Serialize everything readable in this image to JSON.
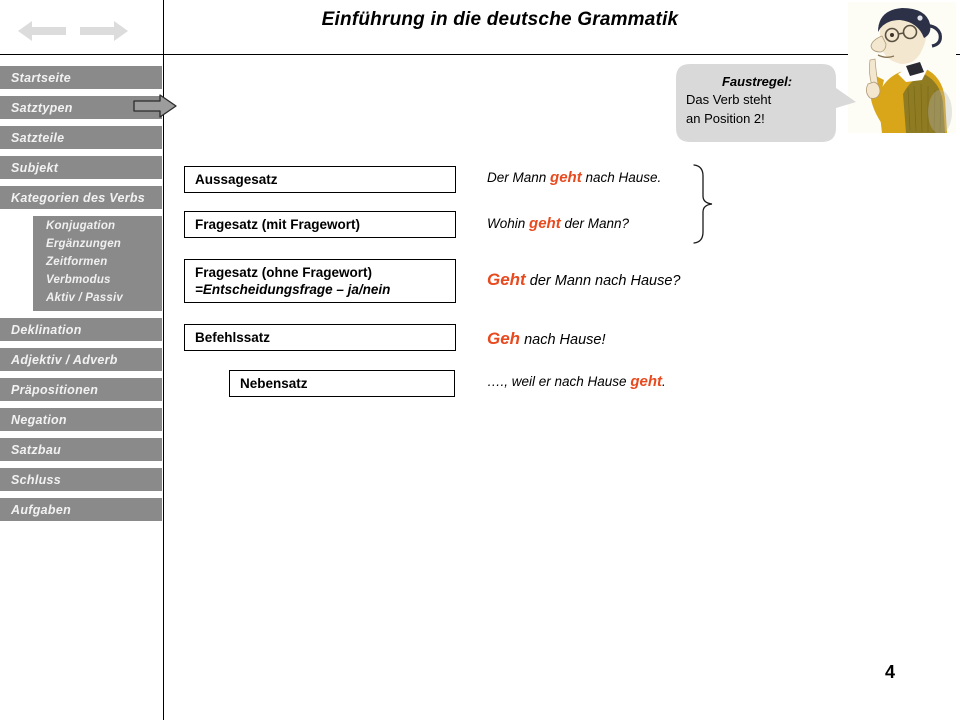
{
  "header": {
    "title": "Einführung in die deutsche Grammatik",
    "nav_back_icon": "arrow-left-icon",
    "nav_forward_icon": "arrow-right-icon"
  },
  "sidebar": {
    "items": [
      {
        "label": "Startseite"
      },
      {
        "label": "Satztypen",
        "active": true
      },
      {
        "label": "Satzteile"
      },
      {
        "label": "Subjekt"
      },
      {
        "label": "Kategorien des Verbs"
      }
    ],
    "subitems": [
      {
        "label": "Konjugation"
      },
      {
        "label": "Ergänzungen"
      },
      {
        "label": "Zeitformen"
      },
      {
        "label": "Verbmodus"
      },
      {
        "label": "Aktiv / Passiv"
      }
    ],
    "items_lower": [
      {
        "label": "Deklination"
      },
      {
        "label": "Adjektiv / Adverb"
      },
      {
        "label": "Präpositionen"
      },
      {
        "label": "Negation"
      },
      {
        "label": "Satzbau"
      },
      {
        "label": "Schluss"
      },
      {
        "label": "Aufgaben"
      }
    ],
    "pointer_icon": "arrow-right-pointer-icon",
    "background_color": "#8a8a8a",
    "text_color": "#f2f2f2"
  },
  "callout": {
    "title": "Faustregel:",
    "line1": "Das Verb steht",
    "line2": "an Position 2!",
    "background_color": "#d9d9d9"
  },
  "illustration": {
    "name": "professor-caricature-image"
  },
  "main": {
    "boxes": [
      {
        "line1": "Aussagesatz",
        "line2": ""
      },
      {
        "line1": "Fragesatz (mit Fragewort)",
        "line2": ""
      },
      {
        "line1": "Fragesatz (ohne Fragewort)",
        "line2": "=Entscheidungsfrage – ja/nein"
      },
      {
        "line1": "Befehlssatz",
        "line2": ""
      },
      {
        "line1": "Nebensatz",
        "line2": ""
      }
    ],
    "examples": [
      {
        "pre": "Der Mann ",
        "hl": "geht",
        "post": " nach Hause."
      },
      {
        "pre": "Wohin ",
        "hl": "geht",
        "post": " der Mann?"
      },
      {
        "pre": "",
        "hl": "Geht",
        "post": " der Mann nach Hause?"
      },
      {
        "pre": "",
        "hl": "Geh",
        "post": " nach Hause!"
      },
      {
        "pre": "…., weil er nach Hause ",
        "hl": "geht",
        "post": "."
      }
    ],
    "highlight_color": "#E8491E",
    "brace_icon": "curly-brace-icon"
  },
  "footer": {
    "page_number": "4"
  }
}
